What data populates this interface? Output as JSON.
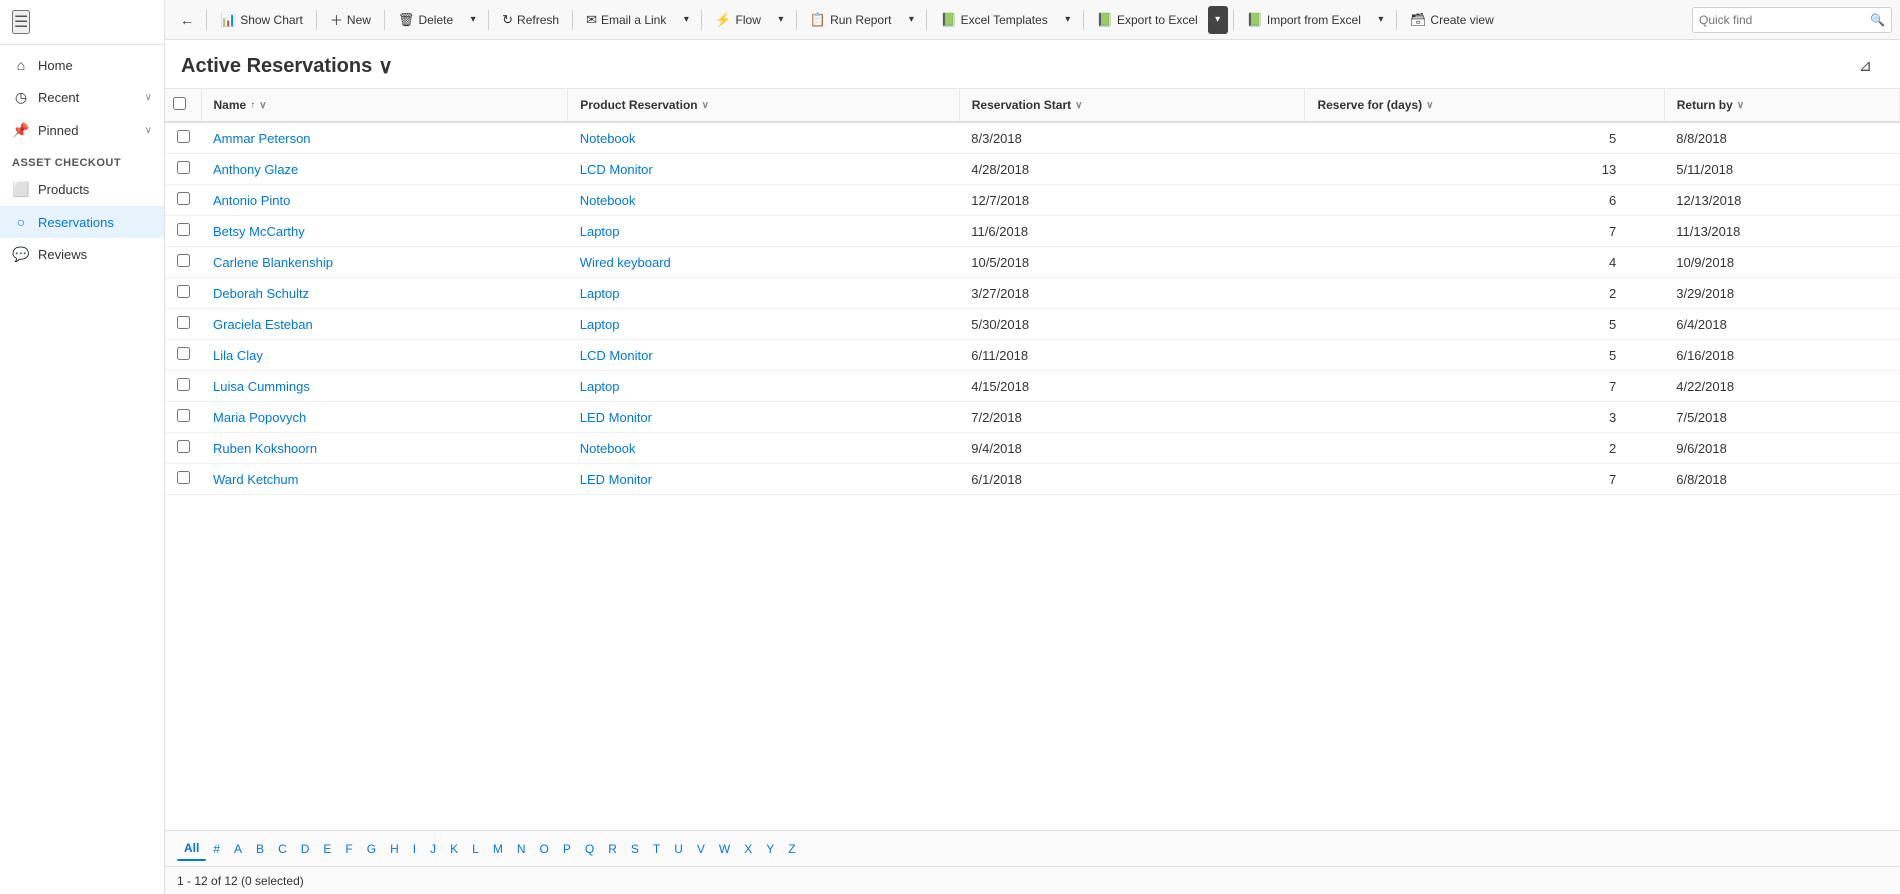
{
  "app": {
    "title": "Asset Checkout"
  },
  "toolbar": {
    "back_label": "←",
    "show_chart_label": "Show Chart",
    "new_label": "New",
    "delete_label": "Delete",
    "refresh_label": "Refresh",
    "email_link_label": "Email a Link",
    "flow_label": "Flow",
    "run_report_label": "Run Report",
    "excel_templates_label": "Excel Templates",
    "export_to_excel_label": "Export to Excel",
    "import_from_excel_label": "Import from Excel",
    "create_view_label": "Create view"
  },
  "quickfind": {
    "label": "Quick find",
    "placeholder": "Quick find"
  },
  "page": {
    "title": "Active Reservations",
    "chevron": "∨"
  },
  "columns": {
    "check": "",
    "name": "Name",
    "name_sort": "↑",
    "product_reservation": "Product Reservation",
    "reservation_start": "Reservation Start",
    "reserve_for_days": "Reserve for (days)",
    "return_by": "Return by"
  },
  "rows": [
    {
      "name": "Ammar Peterson",
      "product": "Notebook",
      "start": "8/3/2018",
      "days": 5,
      "return": "8/8/2018"
    },
    {
      "name": "Anthony Glaze",
      "product": "LCD Monitor",
      "start": "4/28/2018",
      "days": 13,
      "return": "5/11/2018"
    },
    {
      "name": "Antonio Pinto",
      "product": "Notebook",
      "start": "12/7/2018",
      "days": 6,
      "return": "12/13/2018"
    },
    {
      "name": "Betsy McCarthy",
      "product": "Laptop",
      "start": "11/6/2018",
      "days": 7,
      "return": "11/13/2018"
    },
    {
      "name": "Carlene Blankenship",
      "product": "Wired keyboard",
      "start": "10/5/2018",
      "days": 4,
      "return": "10/9/2018"
    },
    {
      "name": "Deborah Schultz",
      "product": "Laptop",
      "start": "3/27/2018",
      "days": 2,
      "return": "3/29/2018"
    },
    {
      "name": "Graciela Esteban",
      "product": "Laptop",
      "start": "5/30/2018",
      "days": 5,
      "return": "6/4/2018"
    },
    {
      "name": "Lila Clay",
      "product": "LCD Monitor",
      "start": "6/11/2018",
      "days": 5,
      "return": "6/16/2018"
    },
    {
      "name": "Luisa Cummings",
      "product": "Laptop",
      "start": "4/15/2018",
      "days": 7,
      "return": "4/22/2018"
    },
    {
      "name": "Maria Popovych",
      "product": "LED Monitor",
      "start": "7/2/2018",
      "days": 3,
      "return": "7/5/2018"
    },
    {
      "name": "Ruben Kokshoorn",
      "product": "Notebook",
      "start": "9/4/2018",
      "days": 2,
      "return": "9/6/2018"
    },
    {
      "name": "Ward Ketchum",
      "product": "LED Monitor",
      "start": "6/1/2018",
      "days": 7,
      "return": "6/8/2018"
    }
  ],
  "pagination": {
    "active": "All",
    "letters": [
      "All",
      "#",
      "A",
      "B",
      "C",
      "D",
      "E",
      "F",
      "G",
      "H",
      "I",
      "J",
      "K",
      "L",
      "M",
      "N",
      "O",
      "P",
      "Q",
      "R",
      "S",
      "T",
      "U",
      "V",
      "W",
      "X",
      "Y",
      "Z"
    ]
  },
  "status": {
    "text": "1 - 12 of 12 (0 selected)"
  },
  "sidebar": {
    "items": [
      {
        "id": "home",
        "label": "Home",
        "icon": "⌂",
        "active": false
      },
      {
        "id": "recent",
        "label": "Recent",
        "icon": "◷",
        "active": false,
        "has_chevron": true
      },
      {
        "id": "pinned",
        "label": "Pinned",
        "icon": "📌",
        "active": false,
        "has_chevron": true
      }
    ],
    "section_label": "Asset Checkout",
    "section_items": [
      {
        "id": "products",
        "label": "Products",
        "icon": "⬜",
        "active": false
      },
      {
        "id": "reservations",
        "label": "Reservations",
        "icon": "○",
        "active": true
      },
      {
        "id": "reviews",
        "label": "Reviews",
        "icon": "💬",
        "active": false
      }
    ]
  },
  "colors": {
    "link": "#0078d4",
    "active_nav": "#0078d4",
    "border": "#e0e0e0"
  }
}
